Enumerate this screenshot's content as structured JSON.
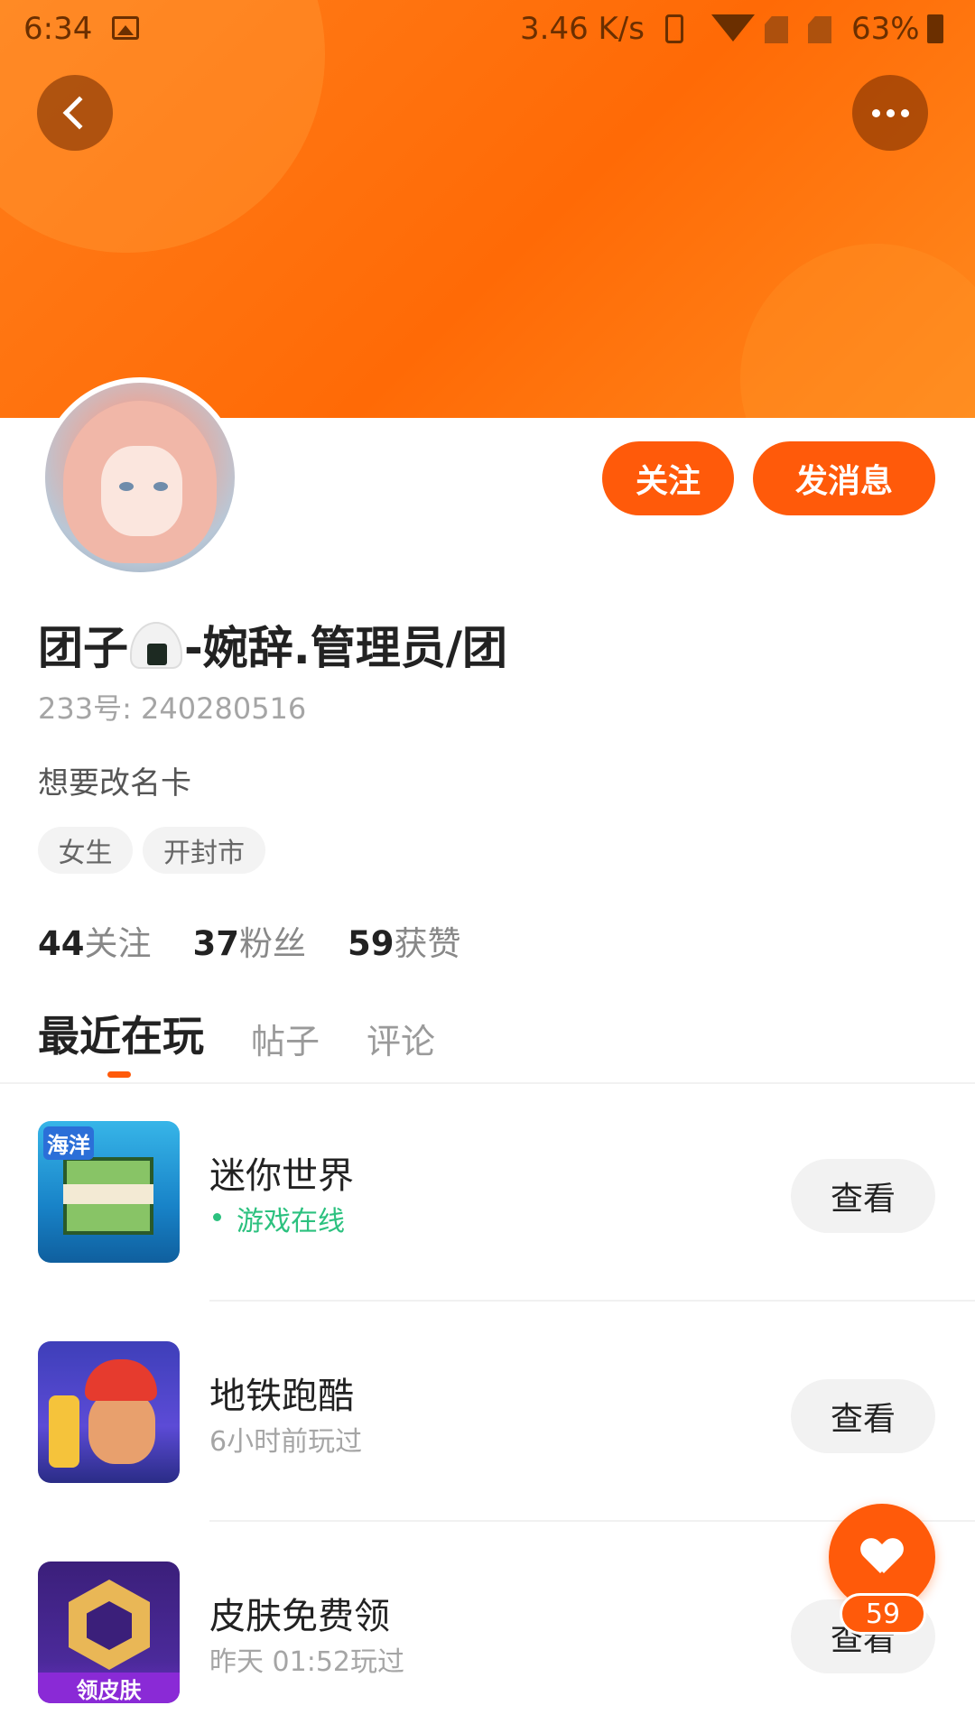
{
  "status_bar": {
    "time": "6:34",
    "speed": "3.46 K/s",
    "battery": "63%"
  },
  "header": {
    "back_icon": "chevron-left-icon",
    "more_icon": "more-dots-icon",
    "colors": {
      "banner": "#ff7414",
      "accent": "#ff5a0a"
    }
  },
  "profile": {
    "follow_label": "关注",
    "message_label": "发消息",
    "name_prefix": "团子",
    "name_suffix": "-婉辞.管理员/团",
    "id_text": "233号:  240280516",
    "bio": "想要改名卡",
    "tags": [
      "女生",
      "开封市"
    ],
    "stats": [
      {
        "num": "44",
        "label": "关注"
      },
      {
        "num": "37",
        "label": "粉丝"
      },
      {
        "num": "59",
        "label": "获赞"
      }
    ]
  },
  "tabs": [
    "最近在玩",
    "帖子",
    "评论"
  ],
  "games": [
    {
      "name": "迷你世界",
      "status": "游戏在线",
      "action": "查看"
    },
    {
      "name": "地铁跑酷",
      "status": "6小时前玩过",
      "action": "查看"
    },
    {
      "name": "皮肤免费领",
      "status": "昨天 01:52玩过",
      "action": "查看"
    }
  ],
  "game_icon_caption_mini": "海洋",
  "game_icon_caption_skin": "领皮肤",
  "like_fab": {
    "count": "59"
  }
}
